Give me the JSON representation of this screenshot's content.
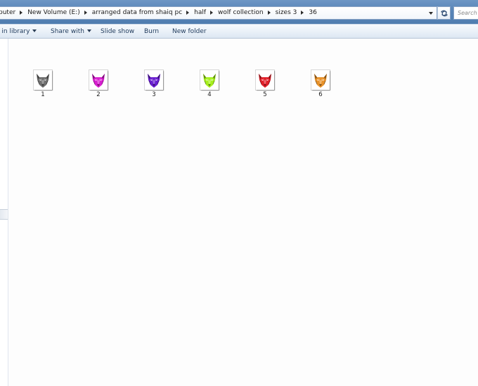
{
  "address": {
    "breadcrumbs": [
      "puter",
      "New Volume (E:)",
      "arranged data from shaiq pc",
      "half",
      "wolf collection",
      "sizes 3",
      "36"
    ],
    "search_placeholder": "Search"
  },
  "toolbar": {
    "include_label": "e in library",
    "share_label": "Share with",
    "slideshow_label": "Slide show",
    "burn_label": "Burn",
    "newfolder_label": "New folder"
  },
  "files": [
    {
      "name": "1",
      "color": "#6f6f6f"
    },
    {
      "name": "2",
      "color": "#d81fd0"
    },
    {
      "name": "3",
      "color": "#6a1fd0"
    },
    {
      "name": "4",
      "color": "#a6f01e"
    },
    {
      "name": "5",
      "color": "#e0202a"
    },
    {
      "name": "6",
      "color": "#e8922a"
    }
  ],
  "icons": {
    "breadcrumb_separator": "chevron-right-icon",
    "history_dropdown": "chevron-down-icon",
    "refresh": "refresh-icon",
    "thumbnail": "wolf-head-icon"
  }
}
